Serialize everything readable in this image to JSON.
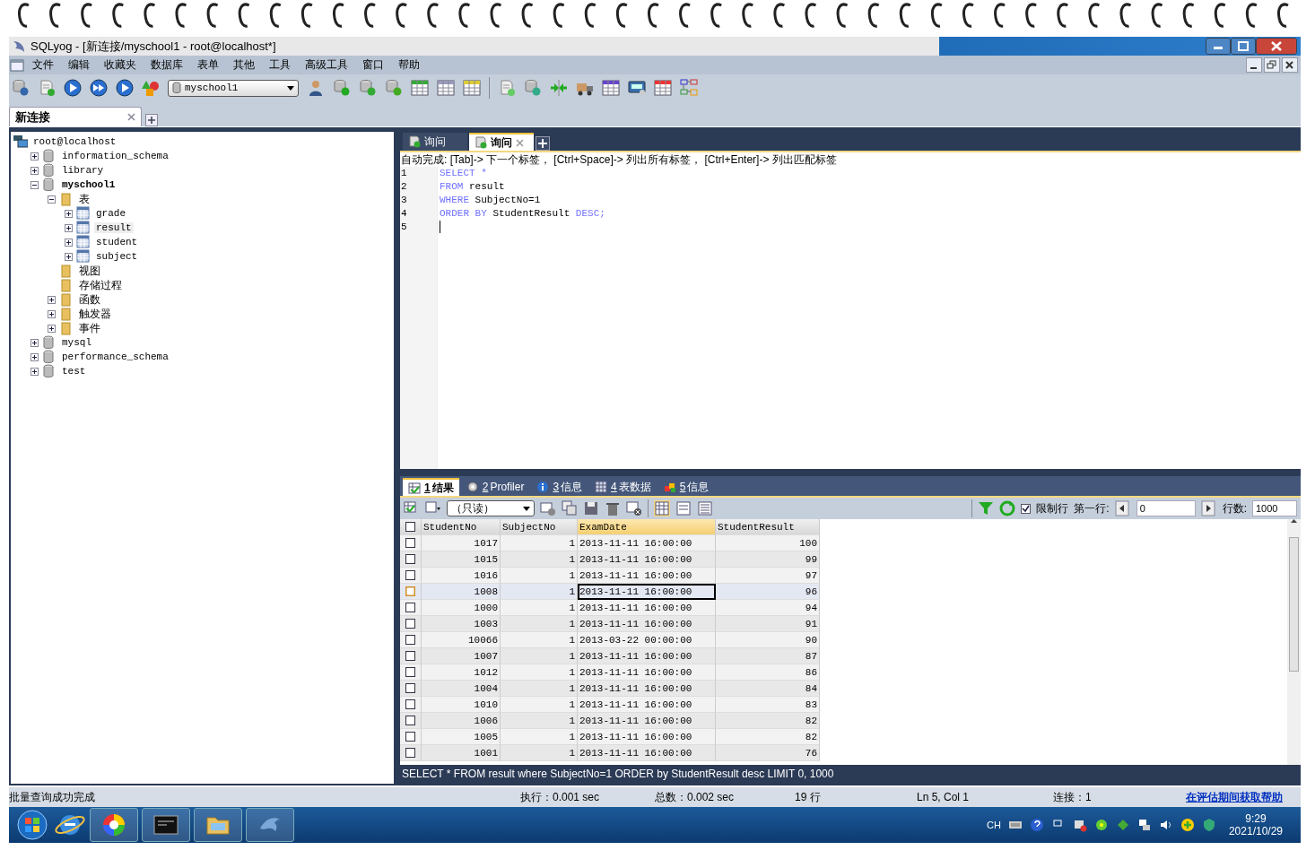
{
  "window": {
    "title": "SQLyog - [新连接/myschool1 - root@localhost*]"
  },
  "menu": [
    "文件",
    "编辑",
    "收藏夹",
    "数据库",
    "表单",
    "其他",
    "工具",
    "高级工具",
    "窗口",
    "帮助"
  ],
  "toolbar": {
    "database_selector": "myschool1"
  },
  "connection_tabs": [
    {
      "label": "新连接",
      "selected": true
    }
  ],
  "tree": [
    {
      "label": "root@localhost",
      "kind": "server",
      "selected": false,
      "children": [
        {
          "label": "information_schema",
          "kind": "database",
          "expanded": false,
          "active": false,
          "selected": false
        },
        {
          "label": "library",
          "kind": "database",
          "expanded": false,
          "active": false,
          "selected": false
        },
        {
          "label": "myschool1",
          "kind": "database",
          "expanded": true,
          "active": true,
          "selected": false,
          "children": [
            {
              "label": "表",
              "kind": "folder",
              "expanded": true,
              "selected": false,
              "children": [
                {
                  "label": "grade",
                  "kind": "table",
                  "expanded": false,
                  "selected": false
                },
                {
                  "label": "result",
                  "kind": "table",
                  "expanded": false,
                  "selected": true
                },
                {
                  "label": "student",
                  "kind": "table",
                  "expanded": false,
                  "selected": false
                },
                {
                  "label": "subject",
                  "kind": "table",
                  "expanded": false,
                  "selected": false
                }
              ]
            },
            {
              "label": "视图",
              "kind": "folder",
              "selected": false
            },
            {
              "label": "存储过程",
              "kind": "folder",
              "selected": false
            },
            {
              "label": "函数",
              "kind": "folder",
              "expanded": false,
              "selected": false
            },
            {
              "label": "触发器",
              "kind": "folder",
              "expanded": false,
              "selected": false
            },
            {
              "label": "事件",
              "kind": "folder",
              "expanded": false,
              "selected": false
            }
          ]
        },
        {
          "label": "mysql",
          "kind": "database",
          "expanded": false,
          "active": false,
          "selected": false
        },
        {
          "label": "performance_schema",
          "kind": "database",
          "expanded": false,
          "active": false,
          "selected": false
        },
        {
          "label": "test",
          "kind": "database",
          "expanded": false,
          "active": false,
          "selected": false
        }
      ]
    }
  ],
  "query_tabs": [
    {
      "label": "询问",
      "selected": false
    },
    {
      "label": "询问",
      "selected": true
    }
  ],
  "autocomplete_hint": "自动完成:  [Tab]-> 下一个标签， [Ctrl+Space]-> 列出所有标签， [Ctrl+Enter]-> 列出匹配标签",
  "editor": {
    "lines": [
      {
        "number": "1",
        "tokens": [
          {
            "text": "SELECT *",
            "kind": "keyword"
          }
        ]
      },
      {
        "number": "2",
        "tokens": [
          {
            "text": "FROM",
            "kind": "keyword"
          },
          {
            "text": " result",
            "kind": "plain"
          }
        ]
      },
      {
        "number": "3",
        "tokens": [
          {
            "text": "WHERE",
            "kind": "keyword"
          },
          {
            "text": " SubjectNo=1",
            "kind": "plain"
          }
        ]
      },
      {
        "number": "4",
        "tokens": [
          {
            "text": "ORDER BY",
            "kind": "keyword"
          },
          {
            "text": " StudentResult ",
            "kind": "plain"
          },
          {
            "text": "DESC;",
            "kind": "keyword"
          }
        ]
      },
      {
        "number": "5"
      }
    ]
  },
  "result_tabs": [
    {
      "key": "1",
      "label": "结果",
      "selected": true
    },
    {
      "key": "2",
      "label": "Profiler",
      "selected": false
    },
    {
      "key": "3",
      "label": "信息",
      "selected": false
    },
    {
      "key": "4",
      "label": "表数据",
      "selected": false
    },
    {
      "key": "5",
      "label": "信息",
      "selected": false
    }
  ],
  "results_toolbar": {
    "mode": "（只读）",
    "limit_rows": {
      "label": "限制行",
      "checked": true
    },
    "first_row_label": "第一行:",
    "first_row": "0",
    "rows_label": "行数:",
    "rows": "1000"
  },
  "grid": {
    "select_all_checked": false,
    "columns": [
      {
        "label": "StudentNo",
        "selected": false
      },
      {
        "label": "SubjectNo",
        "selected": false
      },
      {
        "label": "ExamDate",
        "selected": true
      },
      {
        "label": "StudentResult",
        "selected": false
      }
    ],
    "rows": [
      {
        "cells": [
          "1017",
          "1",
          "2013-11-11 16:00:00",
          "100"
        ],
        "selected": false
      },
      {
        "cells": [
          "1015",
          "1",
          "2013-11-11 16:00:00",
          "99"
        ],
        "selected": false
      },
      {
        "cells": [
          "1016",
          "1",
          "2013-11-11 16:00:00",
          "97"
        ],
        "selected": false
      },
      {
        "cells": [
          "1008",
          "1",
          "2013-11-11 16:00:00",
          "96"
        ],
        "selected": true
      },
      {
        "cells": [
          "1000",
          "1",
          "2013-11-11 16:00:00",
          "94"
        ],
        "selected": false
      },
      {
        "cells": [
          "1003",
          "1",
          "2013-11-11 16:00:00",
          "91"
        ],
        "selected": false
      },
      {
        "cells": [
          "10066",
          "1",
          "2013-03-22 00:00:00",
          "90"
        ],
        "selected": false
      },
      {
        "cells": [
          "1007",
          "1",
          "2013-11-11 16:00:00",
          "87"
        ],
        "selected": false
      },
      {
        "cells": [
          "1012",
          "1",
          "2013-11-11 16:00:00",
          "86"
        ],
        "selected": false
      },
      {
        "cells": [
          "1004",
          "1",
          "2013-11-11 16:00:00",
          "84"
        ],
        "selected": false
      },
      {
        "cells": [
          "1010",
          "1",
          "2013-11-11 16:00:00",
          "83"
        ],
        "selected": false
      },
      {
        "cells": [
          "1006",
          "1",
          "2013-11-11 16:00:00",
          "82"
        ],
        "selected": false
      },
      {
        "cells": [
          "1005",
          "1",
          "2013-11-11 16:00:00",
          "82"
        ],
        "selected": false
      },
      {
        "cells": [
          "1001",
          "1",
          "2013-11-11 16:00:00",
          "76"
        ],
        "selected": false
      }
    ]
  },
  "sql_status": "SELECT * FROM result where SubjectNo=1 ORDER by StudentResult desc LIMIT 0, 1000",
  "status_bar": {
    "message": "批量查询成功完成",
    "exec_time": "执行：0.001 sec",
    "total_time": "总数：0.002 sec",
    "row_count": "19 行",
    "cursor": "Ln 5, Col 1",
    "connections": "连接：1",
    "help_link": "在评估期间获取帮助"
  },
  "taskbar": {
    "input_language": "CH",
    "time": "9:29",
    "date": "2021/10/29"
  }
}
